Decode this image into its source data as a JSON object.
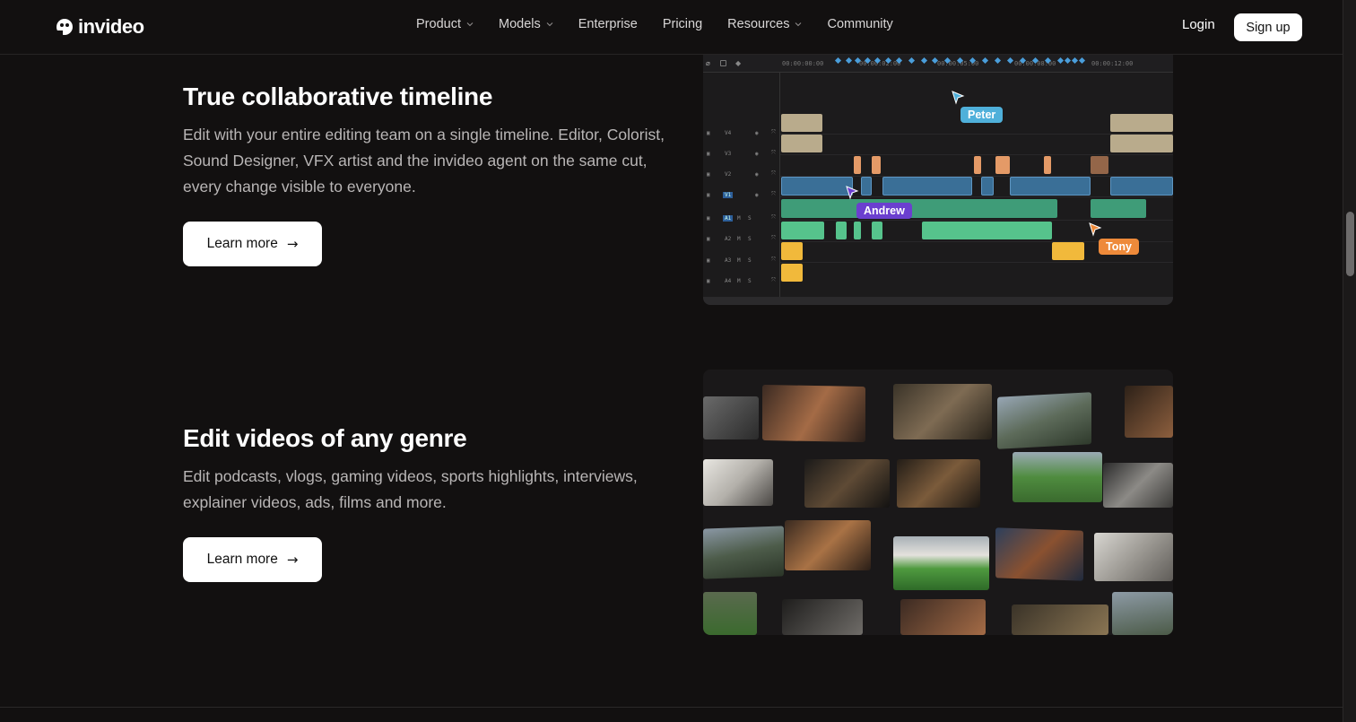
{
  "nav": {
    "logo_text": "invideo",
    "links": [
      {
        "label": "Product",
        "dropdown": true
      },
      {
        "label": "Models",
        "dropdown": true
      },
      {
        "label": "Enterprise",
        "dropdown": false
      },
      {
        "label": "Pricing",
        "dropdown": false
      },
      {
        "label": "Resources",
        "dropdown": true
      },
      {
        "label": "Community",
        "dropdown": false
      }
    ],
    "login": "Login",
    "signup": "Sign up"
  },
  "section1": {
    "title": "True collaborative timeline",
    "description": "Edit with your entire editing team on a single timeline. Editor, Colorist, Sound Designer, VFX artist and the invideo agent on the same cut, every change visible to everyone.",
    "button": "Learn more",
    "timeline": {
      "ruler": [
        "00:00:00:00",
        "00:00:02:00",
        "00:00:05:00",
        "00:00:08:00",
        "00:00:12:00"
      ],
      "tracks": [
        "V4",
        "V3",
        "V2",
        "V1",
        "A1",
        "A2",
        "A3",
        "A4"
      ],
      "collaborators": [
        {
          "name": "Peter",
          "color": "#4fb0da"
        },
        {
          "name": "Andrew",
          "color": "#6b3fcf"
        },
        {
          "name": "Tony",
          "color": "#ee8a3a"
        }
      ]
    }
  },
  "section2": {
    "title": "Edit videos of any genre",
    "description": "Edit podcasts, vlogs, gaming videos, sports highlights, interviews, explainer videos, ads, films and more.",
    "button": "Learn more"
  },
  "colors": {
    "background": "#121010",
    "accent_peter": "#4fb0da",
    "accent_andrew": "#6b3fcf",
    "accent_tony": "#ee8a3a"
  }
}
